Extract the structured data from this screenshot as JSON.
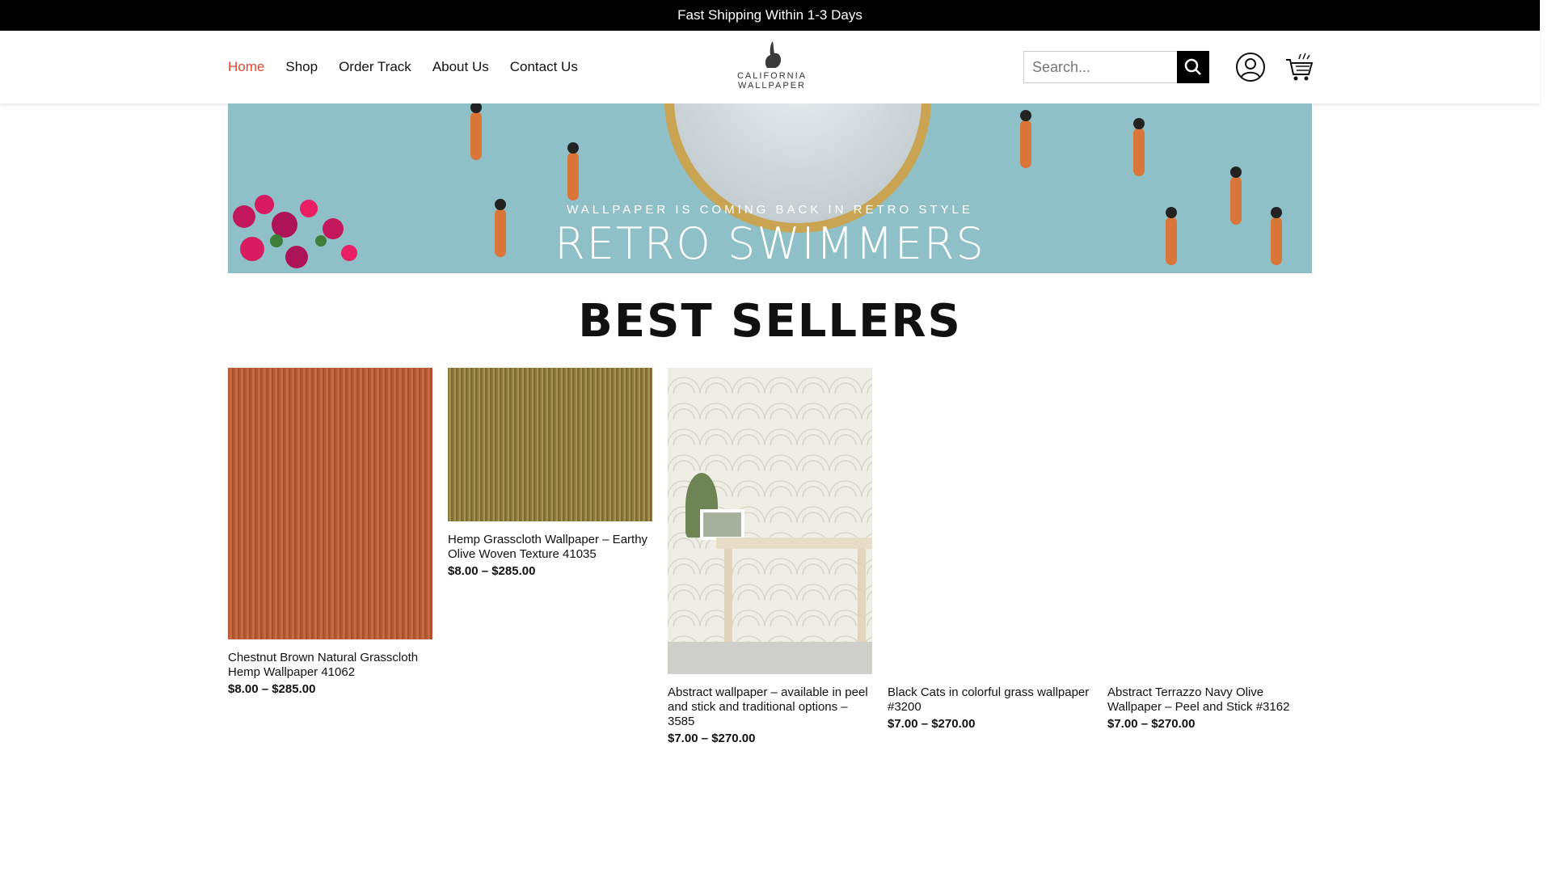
{
  "topbar": {
    "text": "Fast Shipping Within 1-3 Days"
  },
  "nav": {
    "items": [
      "Home",
      "Shop",
      "Order Track",
      "About Us",
      "Contact Us"
    ]
  },
  "logo": {
    "line1": "CALIFORNIA",
    "line2": "WALLPAPER"
  },
  "search": {
    "placeholder": "Search..."
  },
  "hero": {
    "subtitle": "WALLPAPER IS COMING BACK IN RETRO STYLE",
    "title": "RETRO SWIMMERS"
  },
  "section": {
    "title": "BEST SELLERS"
  },
  "products": [
    {
      "name": "Chestnut Brown Natural Grasscloth Hemp Wallpaper 41062",
      "price": "$8.00 – $285.00"
    },
    {
      "name": "Hemp Grasscloth Wallpaper – Earthy Olive Woven Texture 41035",
      "price": "$8.00 – $285.00"
    },
    {
      "name": "Abstract wallpaper – available in peel and stick and traditional options – 3585",
      "price": "$7.00 – $270.00"
    },
    {
      "name": "Black Cats in colorful grass wallpaper #3200",
      "price": "$7.00 – $270.00"
    },
    {
      "name": "Abstract Terrazzo Navy Olive Wallpaper – Peel and Stick #3162",
      "price": "$7.00 – $270.00"
    }
  ],
  "colors": {
    "accent": "#e8452c",
    "topbar": "#000000"
  }
}
